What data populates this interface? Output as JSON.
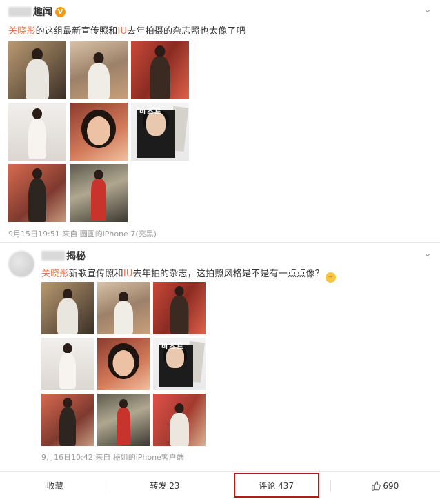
{
  "post1": {
    "author_suffix": "趣闻",
    "verified_badge": "V",
    "text_mention1": "关晓彤",
    "text_part1": "的这组最新宣传照和",
    "text_mention2": "IU",
    "text_part2": "去年拍摄的杂志照也太像了吧",
    "meta": "9月15日19:51 来自 圆圆的iPhone 7(亮黑)",
    "photo_count": 8
  },
  "post2": {
    "author_suffix": "揭秘",
    "text_mention1": "关晓彤",
    "text_part1": "新歌宣传照和",
    "text_mention2": "IU",
    "text_part2": "去年拍的杂志，这拍照风格是不是有一点点像？",
    "meta": "9月16日10:42 来自 秘姐的iPhone客户端",
    "photo_count": 9
  },
  "magazine_title": "비즈르",
  "actions": {
    "favorite": "收藏",
    "repost": "转发 23",
    "comment": "评论 437",
    "like": "690"
  },
  "colors": {
    "mention": "#eb7350",
    "highlight_box": "#b31b1b",
    "verified": "#f29a16"
  }
}
